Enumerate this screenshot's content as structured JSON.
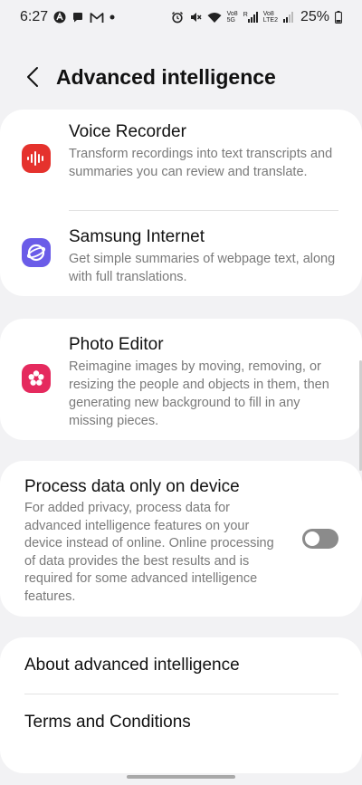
{
  "status_bar": {
    "time": "6:27",
    "battery": "25%",
    "net1": "Vo8",
    "net1b": "5G",
    "net2": "R",
    "net3": "Vo8",
    "net3b": "LTE2"
  },
  "header": {
    "title": "Advanced intelligence"
  },
  "apps": [
    {
      "name": "Voice Recorder",
      "description": "Transform recordings into text transcripts and summaries you can review and translate.",
      "icon": "voice-recorder-icon",
      "color": "#e5322d"
    },
    {
      "name": "Samsung Internet",
      "description": "Get simple summaries of webpage text, along with full translations.",
      "icon": "samsung-internet-icon",
      "color": "#6a5ce8"
    },
    {
      "name": "Photo Editor",
      "description": "Reimagine images by moving, removing, or resizing the people and objects in them, then generating new background to fill in any missing pieces.",
      "icon": "photo-editor-icon",
      "color": "#e52a5e"
    }
  ],
  "process_data": {
    "title": "Process data only on device",
    "description": "For added privacy, process data for advanced intelligence features on your device instead of online. Online processing of data provides the best results and is required for some advanced intelligence features.",
    "enabled": false
  },
  "links": [
    {
      "label": "About advanced intelligence"
    },
    {
      "label": "Terms and Conditions"
    }
  ]
}
